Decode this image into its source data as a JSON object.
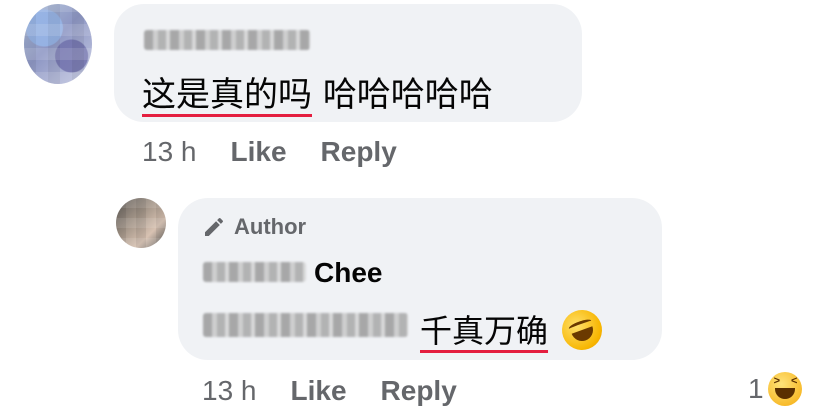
{
  "comment": {
    "text_underlined": "这是真的吗",
    "text_rest": "哈哈哈哈哈",
    "time": "13 h",
    "like_label": "Like",
    "reply_label": "Reply"
  },
  "reply": {
    "badge_label": "Author",
    "author_name_visible": "Chee",
    "text_underlined": "千真万确",
    "emoji": "rolling-on-the-floor-laughing-emoji",
    "time": "13 h",
    "like_label": "Like",
    "reply_label": "Reply",
    "reaction_count": "1",
    "reaction_icon": "haha-icon"
  },
  "colors": {
    "bubble_bg": "#f0f2f5",
    "meta_text": "#65676b",
    "body_text": "#050505",
    "underline": "#e41e3f"
  }
}
